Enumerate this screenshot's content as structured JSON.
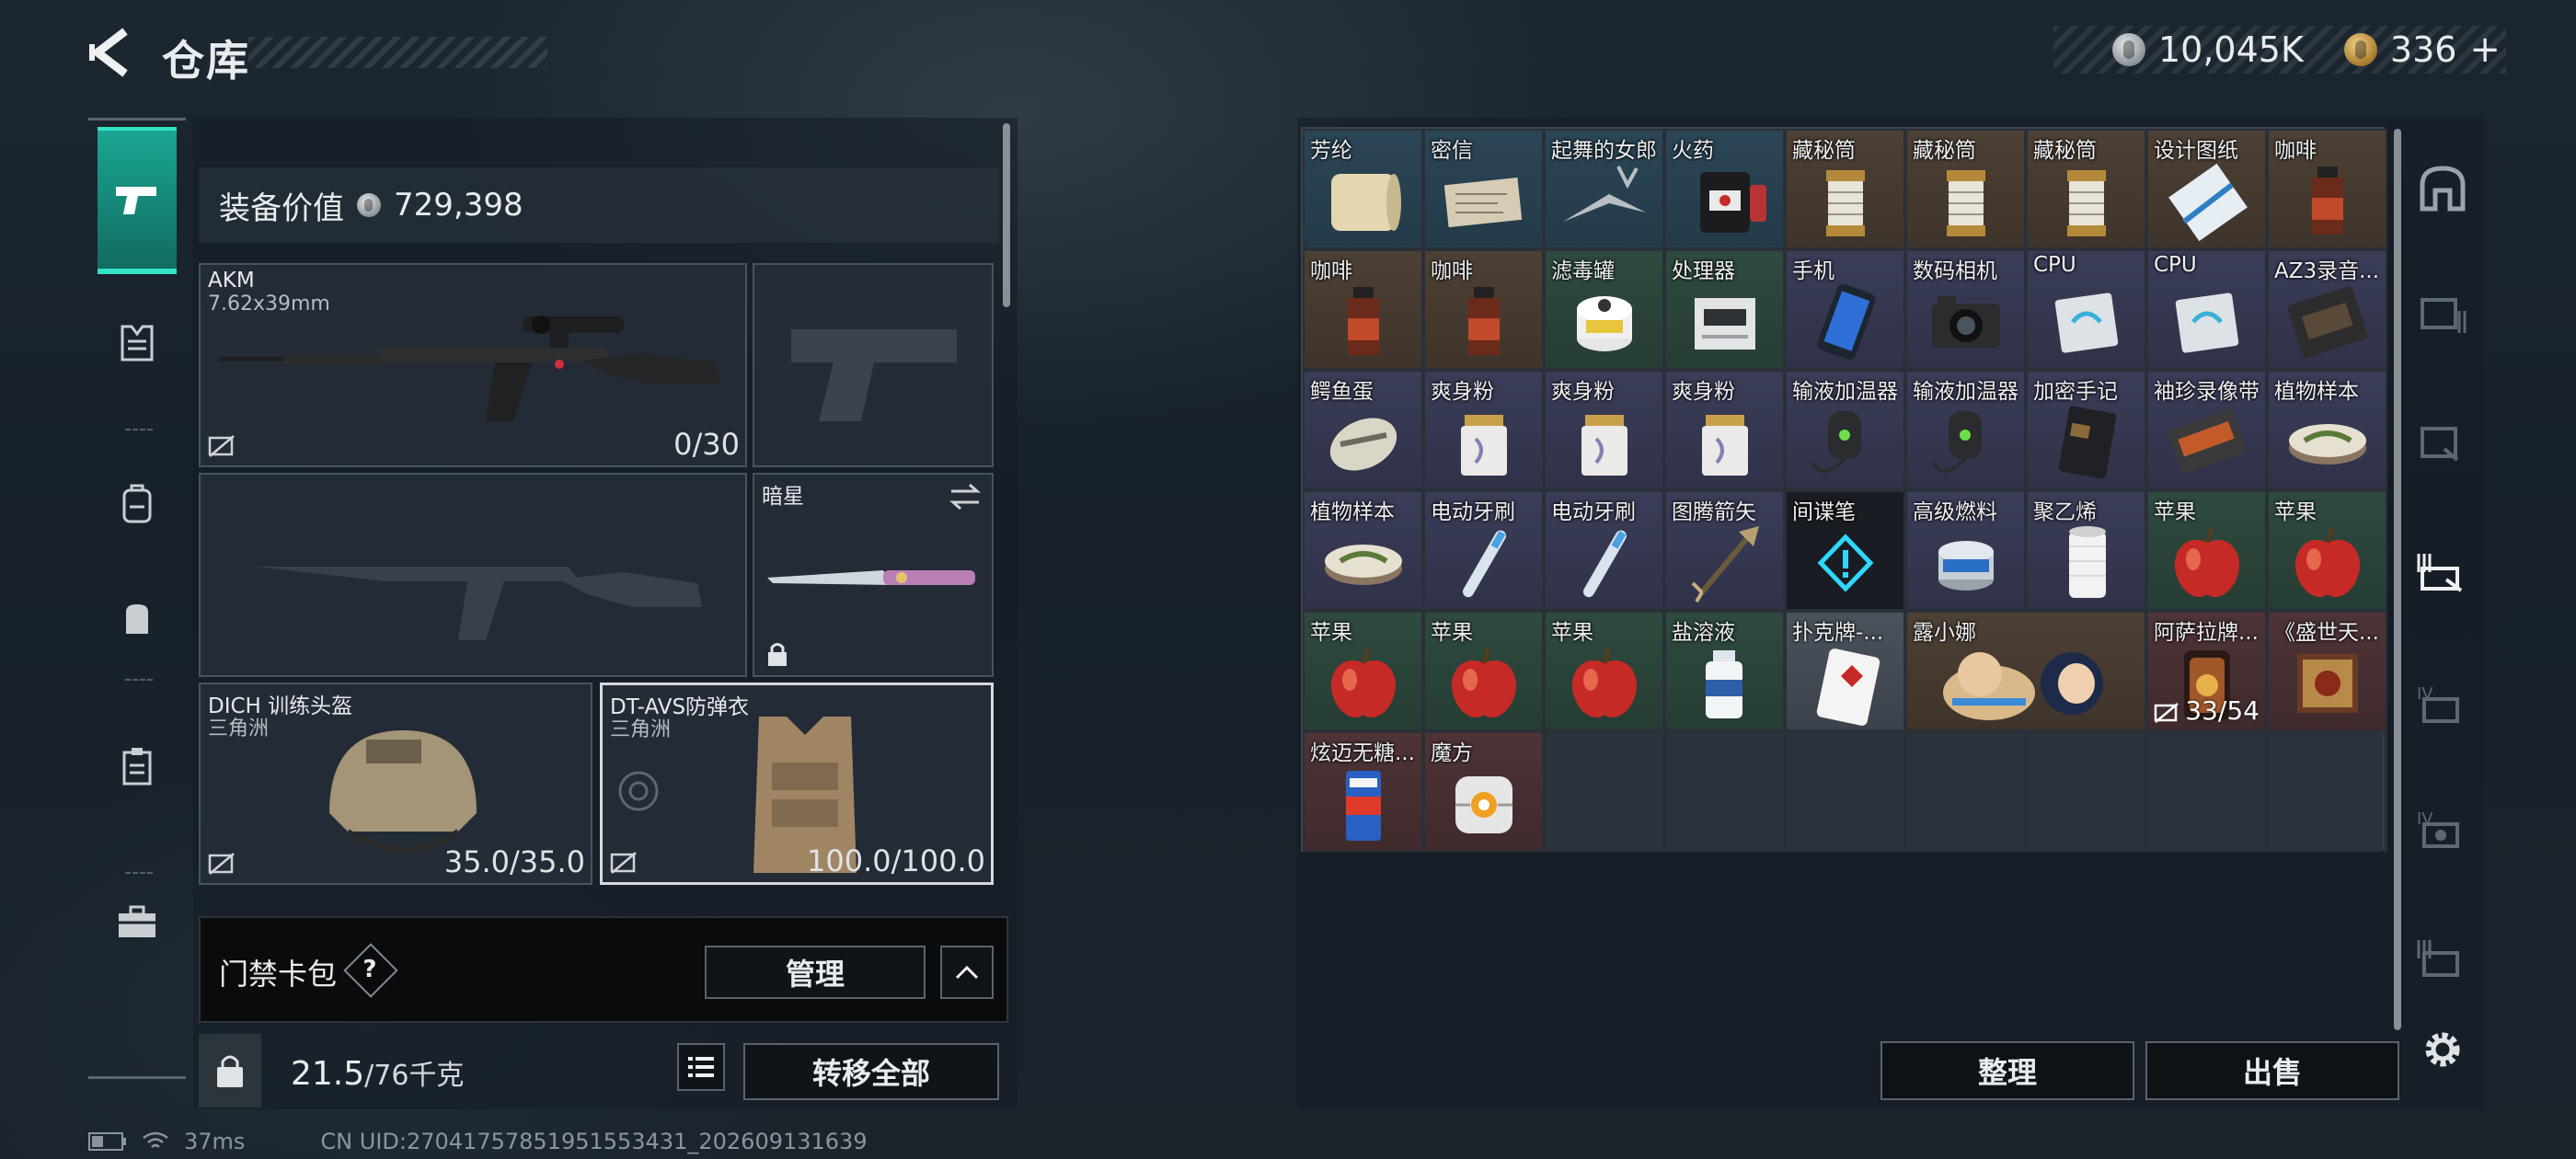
{
  "header": {
    "title": "仓库",
    "silver": "10,045K",
    "gold": "336",
    "gold_plus": "+"
  },
  "equipment": {
    "value_label": "装备价值",
    "value": "729,398",
    "slots": {
      "primary": {
        "name": "AKM",
        "sub": "7.62x39mm",
        "value": "0/30"
      },
      "melee": {
        "name": "暗星"
      },
      "helmet": {
        "name": "DICH 训练头盔",
        "sub": "三角洲",
        "value": "35.0/35.0"
      },
      "armor": {
        "name": "DT-AVS防弹衣",
        "sub": "三角洲",
        "value": "100.0/100.0"
      }
    },
    "keycard_label": "门禁卡包",
    "keycard_help": "?",
    "manage_label": "管理",
    "weight": "21.5",
    "weight_max": "/76千克",
    "transfer_all_label": "转移全部"
  },
  "status": {
    "ping": "37ms",
    "uid": "CN UID:2704175785195155343​1_202609131639"
  },
  "stash": {
    "items": [
      {
        "label": "芳纶",
        "quality": "blue",
        "icon": "fabric-roll-icon"
      },
      {
        "label": "密信",
        "quality": "blue",
        "icon": "letter-icon"
      },
      {
        "label": "起舞的女郎",
        "quality": "blue",
        "icon": "dancer-statue-icon"
      },
      {
        "label": "火药",
        "quality": "blue",
        "icon": "gunpowder-icon"
      },
      {
        "label": "藏秘筒",
        "quality": "gold",
        "icon": "cryptex-icon"
      },
      {
        "label": "藏秘筒",
        "quality": "gold",
        "icon": "cryptex-icon"
      },
      {
        "label": "藏秘筒",
        "quality": "gold",
        "icon": "cryptex-icon"
      },
      {
        "label": "设计图纸",
        "quality": "gold",
        "icon": "blueprint-icon"
      },
      {
        "label": "咖啡",
        "quality": "gold",
        "icon": "coffee-bottle-icon"
      },
      {
        "label": "咖啡",
        "quality": "gold",
        "icon": "coffee-bottle-icon"
      },
      {
        "label": "咖啡",
        "quality": "gold",
        "icon": "coffee-bottle-icon"
      },
      {
        "label": "滤毒罐",
        "quality": "green",
        "icon": "filter-canister-icon"
      },
      {
        "label": "处理器",
        "quality": "green",
        "icon": "processor-box-icon"
      },
      {
        "label": "手机",
        "quality": "purple",
        "icon": "phone-icon"
      },
      {
        "label": "数码相机",
        "quality": "purple",
        "icon": "camera-icon"
      },
      {
        "label": "CPU",
        "quality": "purple",
        "icon": "cpu-icon"
      },
      {
        "label": "CPU",
        "quality": "purple",
        "icon": "cpu-icon"
      },
      {
        "label": "AZ3录音...",
        "quality": "purple",
        "icon": "tape-recorder-icon"
      },
      {
        "label": "鳄鱼蛋",
        "quality": "purple",
        "icon": "crocodile-egg-icon"
      },
      {
        "label": "爽身粉",
        "quality": "purple",
        "icon": "powder-jar-icon"
      },
      {
        "label": "爽身粉",
        "quality": "purple",
        "icon": "powder-jar-icon"
      },
      {
        "label": "爽身粉",
        "quality": "purple",
        "icon": "powder-jar-icon"
      },
      {
        "label": "输液加温器",
        "quality": "purple",
        "icon": "infusion-warmer-icon"
      },
      {
        "label": "输液加温器",
        "quality": "purple",
        "icon": "infusion-warmer-icon"
      },
      {
        "label": "加密手记",
        "quality": "purple",
        "icon": "notebook-icon"
      },
      {
        "label": "袖珍录像带",
        "quality": "purple",
        "icon": "videotape-icon"
      },
      {
        "label": "植物样本",
        "quality": "purple",
        "icon": "petri-dish-icon"
      },
      {
        "label": "植物样本",
        "quality": "purple",
        "icon": "petri-dish-icon"
      },
      {
        "label": "电动牙刷",
        "quality": "purple",
        "icon": "toothbrush-icon"
      },
      {
        "label": "电动牙刷",
        "quality": "purple",
        "icon": "toothbrush-icon"
      },
      {
        "label": "图腾箭矢",
        "quality": "purple",
        "icon": "totem-arrow-icon"
      },
      {
        "label": "间谍笔",
        "quality": "dark",
        "icon": "alert-icon"
      },
      {
        "label": "高级燃料",
        "quality": "purple",
        "icon": "fuel-can-icon"
      },
      {
        "label": "聚乙烯",
        "quality": "purple",
        "icon": "polyethylene-spool-icon"
      },
      {
        "label": "苹果",
        "quality": "green",
        "icon": "apple-icon"
      },
      {
        "label": "苹果",
        "quality": "green",
        "icon": "apple-icon"
      },
      {
        "label": "苹果",
        "quality": "green",
        "icon": "apple-icon"
      },
      {
        "label": "苹果",
        "quality": "green",
        "icon": "apple-icon"
      },
      {
        "label": "苹果",
        "quality": "green",
        "icon": "apple-icon"
      },
      {
        "label": "盐溶液",
        "quality": "green",
        "icon": "saline-bottle-icon"
      },
      {
        "label": "扑克牌-...",
        "quality": "grey",
        "icon": "poker-card-icon"
      },
      {
        "label": "露小娜",
        "quality": "gold",
        "icon": "plush-doll-icon",
        "wide": true
      },
      {
        "label": "阿萨拉牌...",
        "quality": "red",
        "icon": "asala-card-icon",
        "count": "33/54"
      },
      {
        "label": "《盛世天...",
        "quality": "red",
        "icon": "painting-icon"
      },
      {
        "label": "炫迈无糖...",
        "quality": "red",
        "icon": "gum-pack-icon"
      },
      {
        "label": "魔方",
        "quality": "red",
        "icon": "cube-device-icon"
      }
    ],
    "sort_label": "整理",
    "sell_label": "出售"
  },
  "colors": {
    "accent": "#1aa692",
    "panel_bg": "#1c2630"
  }
}
